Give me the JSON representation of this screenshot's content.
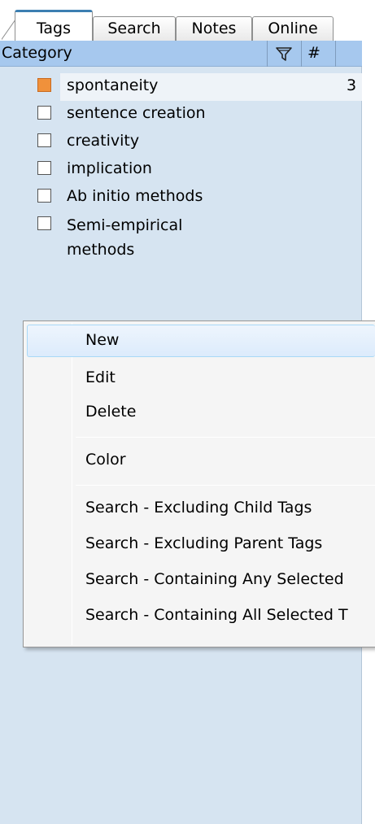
{
  "tabs": [
    {
      "label": "Tags",
      "active": true
    },
    {
      "label": "Search",
      "active": false
    },
    {
      "label": "Notes",
      "active": false
    },
    {
      "label": "Online",
      "active": false
    }
  ],
  "header": {
    "category_label": "Category",
    "filter_icon": "funnel-icon",
    "count_label": "#"
  },
  "tags": [
    {
      "label": "spontaneity",
      "count": "3",
      "color": "#f0913b",
      "selected": true
    },
    {
      "label": "sentence creation",
      "count": "",
      "color": "",
      "selected": false
    },
    {
      "label": "creativity",
      "count": "",
      "color": "",
      "selected": false
    },
    {
      "label": "implication",
      "count": "",
      "color": "",
      "selected": false
    },
    {
      "label": "Ab initio methods",
      "count": "",
      "color": "",
      "selected": false
    },
    {
      "label": "Semi-empirical methods",
      "count": "",
      "color": "",
      "selected": false
    }
  ],
  "context_menu": {
    "items": [
      {
        "label": "New"
      },
      {
        "label": "Edit"
      },
      {
        "label": "Delete"
      },
      {
        "label": "Color"
      },
      {
        "label": "Search - Excluding Child Tags"
      },
      {
        "label": "Search - Excluding Parent Tags"
      },
      {
        "label": "Search - Containing Any Selected"
      },
      {
        "label": "Search - Containing All Selected T"
      }
    ]
  },
  "colors": {
    "panel_bg": "#d6e4f1",
    "header_bg": "#a6c8ee",
    "accent": "#3c7fb1",
    "tag_orange": "#f0913b"
  }
}
